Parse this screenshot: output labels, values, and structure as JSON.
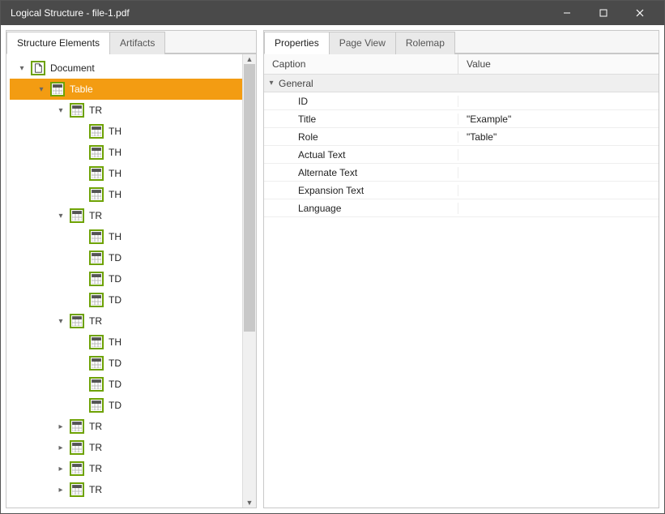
{
  "window": {
    "title": "Logical Structure - file-1.pdf"
  },
  "left": {
    "tabs": {
      "structure": "Structure Elements",
      "artifacts": "Artifacts"
    },
    "tree": [
      {
        "indent": 0,
        "exp": "down",
        "icon": "doc",
        "label": "Document",
        "sel": false
      },
      {
        "indent": 1,
        "exp": "down",
        "icon": "table",
        "label": "Table",
        "sel": true
      },
      {
        "indent": 2,
        "exp": "down",
        "icon": "table",
        "label": "TR",
        "sel": false
      },
      {
        "indent": 3,
        "exp": "",
        "icon": "table",
        "label": "TH",
        "sel": false
      },
      {
        "indent": 3,
        "exp": "",
        "icon": "table",
        "label": "TH",
        "sel": false
      },
      {
        "indent": 3,
        "exp": "",
        "icon": "table",
        "label": "TH",
        "sel": false
      },
      {
        "indent": 3,
        "exp": "",
        "icon": "table",
        "label": "TH",
        "sel": false
      },
      {
        "indent": 2,
        "exp": "down",
        "icon": "table",
        "label": "TR",
        "sel": false
      },
      {
        "indent": 3,
        "exp": "",
        "icon": "table",
        "label": "TH",
        "sel": false
      },
      {
        "indent": 3,
        "exp": "",
        "icon": "table",
        "label": "TD",
        "sel": false
      },
      {
        "indent": 3,
        "exp": "",
        "icon": "table",
        "label": "TD",
        "sel": false
      },
      {
        "indent": 3,
        "exp": "",
        "icon": "table",
        "label": "TD",
        "sel": false
      },
      {
        "indent": 2,
        "exp": "down",
        "icon": "table",
        "label": "TR",
        "sel": false
      },
      {
        "indent": 3,
        "exp": "",
        "icon": "table",
        "label": "TH",
        "sel": false
      },
      {
        "indent": 3,
        "exp": "",
        "icon": "table",
        "label": "TD",
        "sel": false
      },
      {
        "indent": 3,
        "exp": "",
        "icon": "table",
        "label": "TD",
        "sel": false
      },
      {
        "indent": 3,
        "exp": "",
        "icon": "table",
        "label": "TD",
        "sel": false
      },
      {
        "indent": 2,
        "exp": "right",
        "icon": "table",
        "label": "TR",
        "sel": false
      },
      {
        "indent": 2,
        "exp": "right",
        "icon": "table",
        "label": "TR",
        "sel": false
      },
      {
        "indent": 2,
        "exp": "right",
        "icon": "table",
        "label": "TR",
        "sel": false
      },
      {
        "indent": 2,
        "exp": "right",
        "icon": "table",
        "label": "TR",
        "sel": false
      }
    ]
  },
  "right": {
    "tabs": {
      "properties": "Properties",
      "pageview": "Page View",
      "rolemap": "Rolemap"
    },
    "headers": {
      "caption": "Caption",
      "value": "Value"
    },
    "group": "General",
    "rows": [
      {
        "caption": "ID",
        "value": ""
      },
      {
        "caption": "Title",
        "value": "\"Example\""
      },
      {
        "caption": "Role",
        "value": "\"Table\""
      },
      {
        "caption": "Actual Text",
        "value": ""
      },
      {
        "caption": "Alternate Text",
        "value": ""
      },
      {
        "caption": "Expansion Text",
        "value": ""
      },
      {
        "caption": "Language",
        "value": ""
      }
    ]
  }
}
